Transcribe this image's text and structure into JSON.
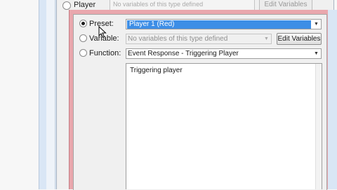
{
  "background_window": {
    "player_label": "Player",
    "dropdown_text": "No variables of this type defined",
    "edit_button_label": "Edit Variables"
  },
  "dialog": {
    "options": [
      {
        "label": "Preset:",
        "selected": true
      },
      {
        "label": "Variable:",
        "selected": false
      },
      {
        "label": "Function:",
        "selected": false
      }
    ],
    "preset_value": "Player 1 (Red)",
    "variable_value": "No variables of this type defined",
    "edit_variables_label": "Edit Variables",
    "function_value": "Event Response - Triggering Player",
    "description": "Triggering player"
  },
  "colors": {
    "selection": "#3d8ee6",
    "frame": "#e9a7ad",
    "dialog_bg": "#f0f0f0"
  },
  "icons": [
    "dropdown-arrow-icon",
    "mouse-cursor-icon"
  ]
}
